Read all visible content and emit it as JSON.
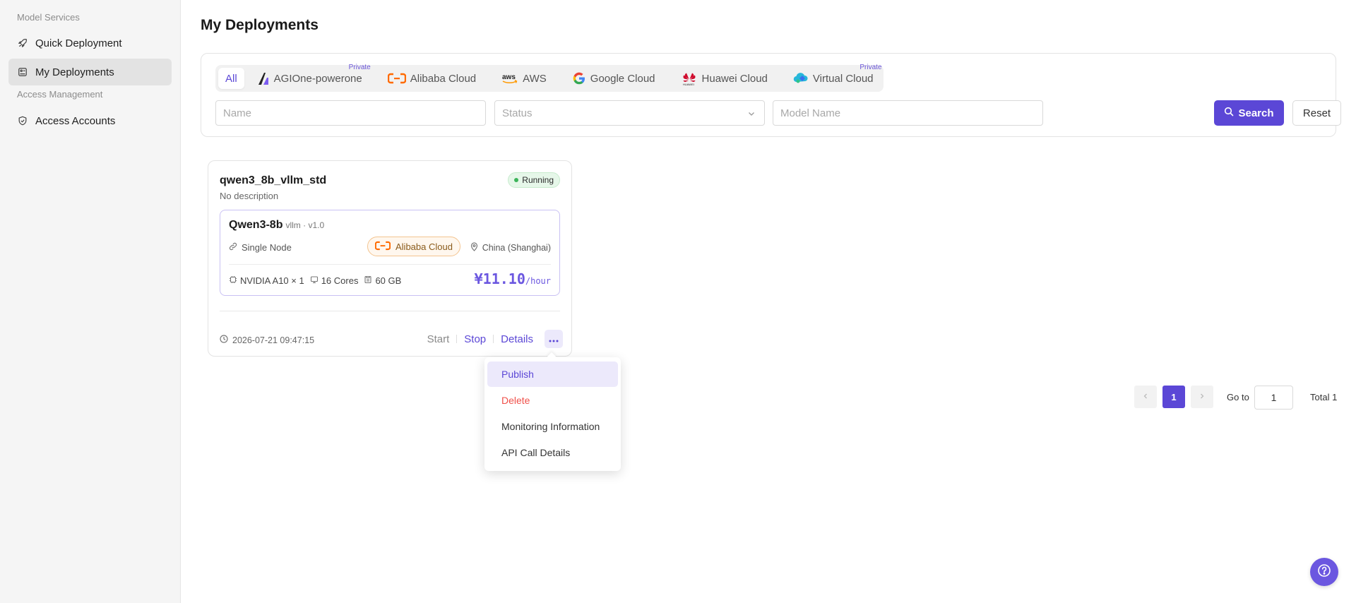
{
  "sidebar": {
    "sections": [
      {
        "title": "Model Services",
        "items": [
          {
            "label": "Quick Deployment",
            "icon": "rocket-icon"
          },
          {
            "label": "My Deployments",
            "icon": "deployments-icon",
            "active": true
          }
        ]
      },
      {
        "title": "Access Management",
        "items": [
          {
            "label": "Access Accounts",
            "icon": "shield-icon"
          }
        ]
      }
    ]
  },
  "page": {
    "title": "My Deployments"
  },
  "filters": {
    "providers": [
      {
        "label": "All",
        "active": true
      },
      {
        "label": "AGIOne-powerone",
        "badge": "Private",
        "icon": "agione-logo-icon"
      },
      {
        "label": "Alibaba Cloud",
        "icon": "alibaba-cloud-logo-icon"
      },
      {
        "label": "AWS",
        "icon": "aws-logo-icon"
      },
      {
        "label": "Google Cloud",
        "icon": "google-cloud-logo-icon"
      },
      {
        "label": "Huawei Cloud",
        "icon": "huawei-cloud-logo-icon"
      },
      {
        "label": "Virtual Cloud",
        "badge": "Private",
        "icon": "virtual-cloud-logo-icon"
      }
    ],
    "name_placeholder": "Name",
    "status_placeholder": "Status",
    "model_placeholder": "Model Name",
    "search_label": "Search",
    "reset_label": "Reset"
  },
  "card": {
    "name": "qwen3_8b_vllm_std",
    "description": "No description",
    "status": "Running",
    "model": {
      "name": "Qwen3-8b",
      "version": "vllm · v1.0",
      "node": "Single Node",
      "provider": "Alibaba Cloud",
      "region": "China (Shanghai)",
      "gpu": "NVIDIA A10 × 1",
      "cpu": "16 Cores",
      "memory": "60 GB",
      "price": "¥11.10",
      "price_unit": "/hour"
    },
    "created": "2026-07-21 09:47:15",
    "actions": {
      "start": "Start",
      "stop": "Stop",
      "details": "Details"
    }
  },
  "dropdown": {
    "items": [
      {
        "label": "Publish",
        "active": true
      },
      {
        "label": "Delete",
        "danger": true
      },
      {
        "label": "Monitoring Information"
      },
      {
        "label": "API Call Details"
      }
    ]
  },
  "pagination": {
    "current": "1",
    "goto_label": "Go to",
    "goto_value": "1",
    "total": "Total 1"
  },
  "colors": {
    "accent": "#5b47d6",
    "success": "#3cb45a",
    "danger": "#f0504a",
    "alibaba": "#ff6a00"
  }
}
